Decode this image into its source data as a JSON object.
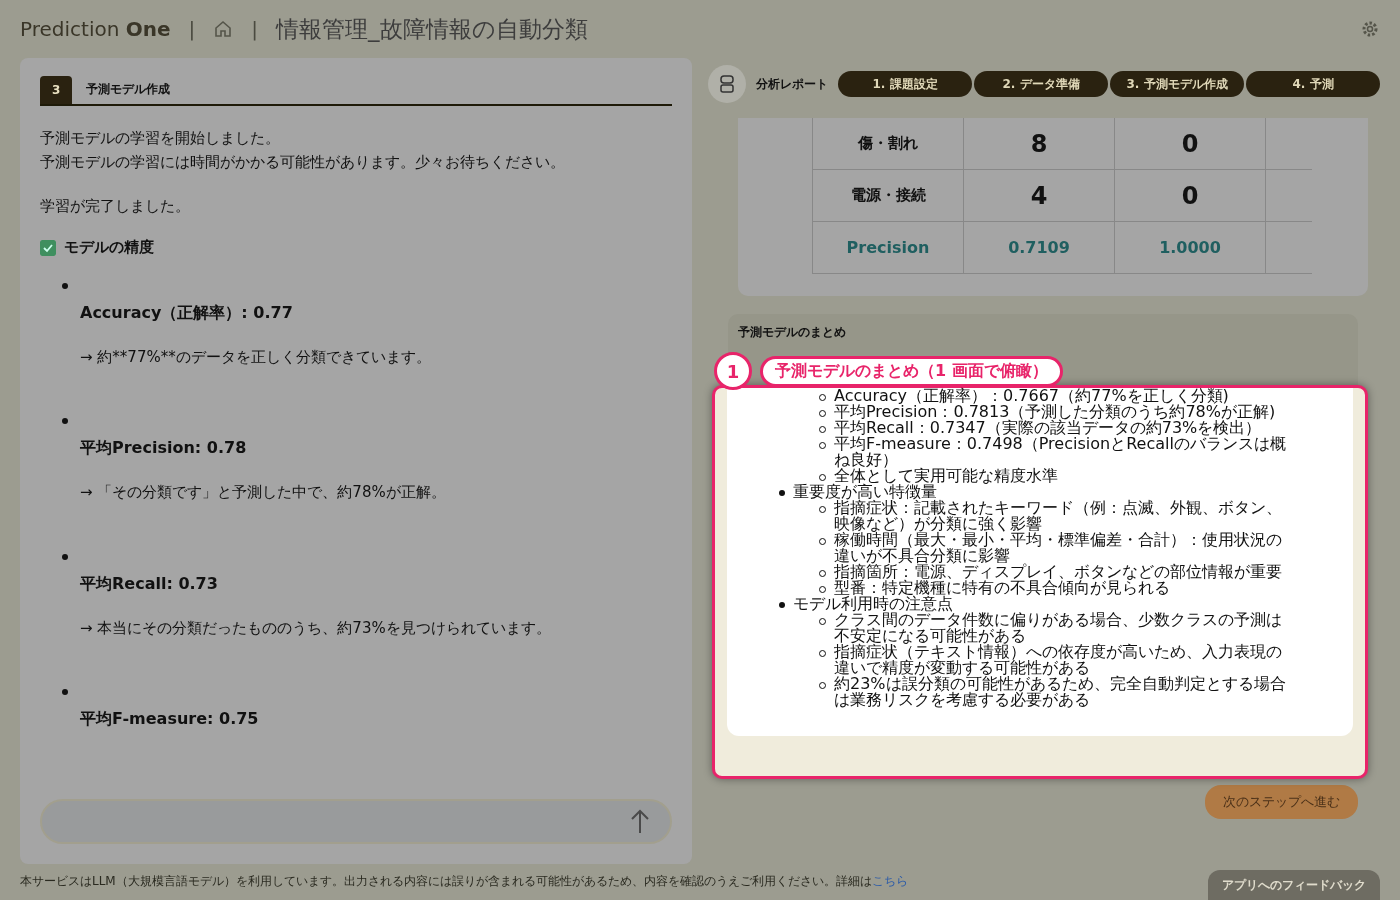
{
  "header": {
    "brand": {
      "light": "Prediction",
      "bold": "One"
    },
    "separators": [
      "|",
      "|"
    ],
    "title": "情報管理_故障情報の自動分類"
  },
  "step": {
    "number": "3",
    "title": "予測モデル作成"
  },
  "messages": [
    "予測モデルの学習を開始しました。",
    "予測モデルの学習には時間がかかる可能性があります。少々お待ちください。",
    "学習が完了しました。"
  ],
  "accuracy_section": {
    "title": "モデルの精度",
    "checked": true,
    "metrics": [
      {
        "title": "Accuracy（正解率）: 0.77",
        "description": "→ 約**77%**のデータを正しく分類できています。"
      },
      {
        "title": "平均Precision: 0.78",
        "description": "→ 「その分類です」と予測した中で、約78%が正解。"
      },
      {
        "title": "平均Recall: 0.73",
        "description": "→ 本当にその分類だったもののうち、約73%を見つけられています。"
      },
      {
        "title": "平均F-measure: 0.75"
      }
    ]
  },
  "report": {
    "label": "分析レポート",
    "steps": [
      "1. 課題設定",
      "2. データ準備",
      "3. 予測モデル作成",
      "4. 予測"
    ]
  },
  "table": {
    "rows": [
      {
        "kind": "count",
        "label": "傷・割れ",
        "values": [
          "8",
          "0"
        ]
      },
      {
        "kind": "count",
        "label": "電源・接続",
        "values": [
          "4",
          "0"
        ]
      },
      {
        "kind": "precision",
        "label": "Precision",
        "values": [
          "0.7109",
          "1.0000"
        ]
      }
    ]
  },
  "summary": {
    "title": "予測モデルのまとめ",
    "callout": {
      "number": "1",
      "label": "予測モデルのまとめ（1 画面で俯瞰）"
    },
    "items": [
      {
        "children": [
          {
            "text": "Accuracy（正解率）：0.7667（約77%を正しく分類)"
          },
          {
            "text": "平均Precision：0.7813（予測した分類のうち約78%が正解)"
          },
          {
            "text": "平均Recall：0.7347（実際の該当データの約73%を検出）"
          },
          {
            "text": "平均F-measure：0.7498（PrecisionとRecallのバランスは概ね良好）"
          },
          {
            "text": "全体として実用可能な精度水準"
          }
        ]
      },
      {
        "text": "重要度が高い特徴量",
        "children": [
          {
            "text": "指摘症状：記載されたキーワード（例：点滅、外観、ボタン、映像など）が分類に強く影響"
          },
          {
            "text": "稼働時間（最大・最小・平均・標準偏差・合計）：使用状況の違いが不具合分類に影響"
          },
          {
            "text": "指摘箇所：電源、ディスプレイ、ボタンなどの部位情報が重要"
          },
          {
            "text": "型番：特定機種に特有の不具合傾向が見られる"
          }
        ]
      },
      {
        "text": "モデル利用時の注意点",
        "children": [
          {
            "text": "クラス間のデータ件数に偏りがある場合、少数クラスの予測は不安定になる可能性がある"
          },
          {
            "text": "指摘症状（テキスト情報）への依存度が高いため、入力表現の違いで精度が変動する可能性がある"
          },
          {
            "text": "約23%は誤分類の可能性があるため、完全自動判定とする場合は業務リスクを考慮する必要がある"
          }
        ]
      }
    ]
  },
  "next_button": "次のステップへ進む",
  "footer": {
    "notice": "本サービスはLLM（大規模言語モデル）を利用しています。出力される内容には誤りが含まれる可能性があるため、内容を確認のうえご利用ください。詳細は",
    "link": "こちら"
  },
  "feedback_button": "アプリへのフィードバック"
}
